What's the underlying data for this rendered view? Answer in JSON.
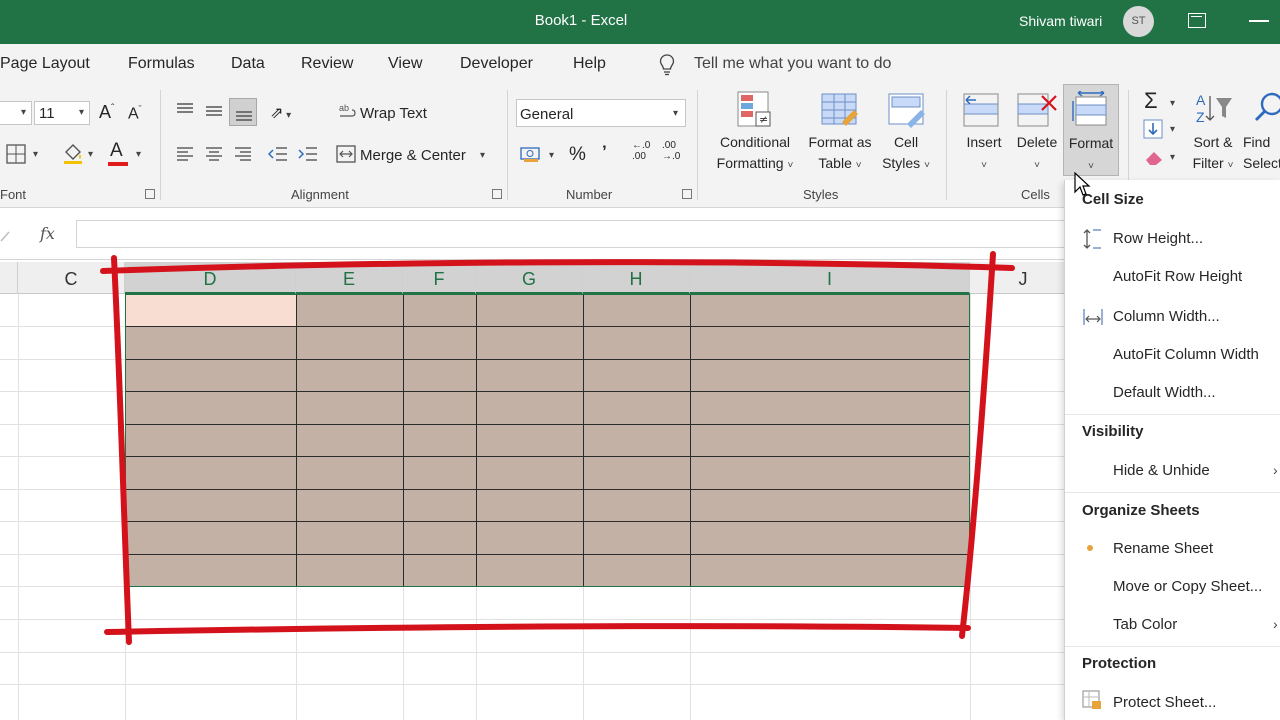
{
  "titlebar": {
    "title": "Book1  -  Excel",
    "user_name": "Shivam tiwari",
    "avatar_initials": "ST"
  },
  "tabs": [
    {
      "label": "Page Layout"
    },
    {
      "label": "Formulas"
    },
    {
      "label": "Data"
    },
    {
      "label": "Review"
    },
    {
      "label": "View"
    },
    {
      "label": "Developer"
    },
    {
      "label": "Help"
    }
  ],
  "tell_me": "Tell me what you want to do",
  "ribbon": {
    "font": {
      "size": "11",
      "group_label": "Font"
    },
    "alignment": {
      "wrap_text": "Wrap Text",
      "merge_center": "Merge & Center",
      "group_label": "Alignment"
    },
    "number": {
      "format": "General",
      "percent": "%",
      "comma": "9",
      "group_label": "Number"
    },
    "styles": {
      "conditional_l1": "Conditional",
      "conditional_l2": "Formatting",
      "table_l1": "Format as",
      "table_l2": "Table",
      "cell_l1": "Cell",
      "cell_l2": "Styles",
      "group_label": "Styles"
    },
    "cells": {
      "insert": "Insert",
      "delete": "Delete",
      "format": "Format",
      "group_label": "Cells"
    },
    "editing": {
      "sort_l1": "Sort &",
      "sort_l2": "Filter",
      "find_l1": "Find",
      "find_l2": "Select"
    }
  },
  "formula_bar": {
    "fx": "fx"
  },
  "columns": [
    "C",
    "D",
    "E",
    "F",
    "G",
    "H",
    "I",
    "J"
  ],
  "menu": {
    "cell_size": "Cell Size",
    "row_height": "Row Height...",
    "autofit_row": "AutoFit Row Height",
    "column_width": "Column Width...",
    "autofit_column": "AutoFit Column Width",
    "default_width": "Default Width...",
    "visibility": "Visibility",
    "hide_unhide": "Hide & Unhide",
    "organize": "Organize Sheets",
    "rename": "Rename Sheet",
    "move_copy": "Move or Copy Sheet...",
    "tab_color": "Tab Color",
    "protection": "Protection",
    "protect": "Protect Sheet..."
  },
  "colors": {
    "excel_green": "#217346",
    "selection_fill": "#c3b1a6",
    "annotation_red": "#d4121c"
  }
}
